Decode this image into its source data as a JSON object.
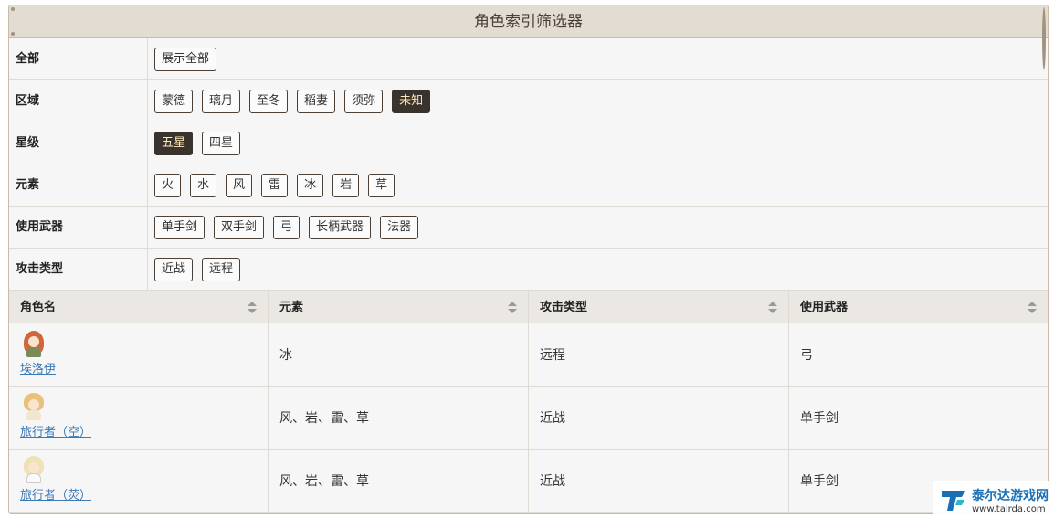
{
  "title": "角色索引筛选器",
  "filters": [
    {
      "label": "全部",
      "options": [
        {
          "text": "展示全部",
          "active": false
        }
      ]
    },
    {
      "label": "区域",
      "options": [
        {
          "text": "蒙德",
          "active": false
        },
        {
          "text": "璃月",
          "active": false
        },
        {
          "text": "至冬",
          "active": false
        },
        {
          "text": "稻妻",
          "active": false
        },
        {
          "text": "须弥",
          "active": false
        },
        {
          "text": "未知",
          "active": true
        }
      ]
    },
    {
      "label": "星级",
      "options": [
        {
          "text": "五星",
          "active": true
        },
        {
          "text": "四星",
          "active": false
        }
      ]
    },
    {
      "label": "元素",
      "options": [
        {
          "text": "火",
          "active": false
        },
        {
          "text": "水",
          "active": false
        },
        {
          "text": "风",
          "active": false
        },
        {
          "text": "雷",
          "active": false
        },
        {
          "text": "冰",
          "active": false
        },
        {
          "text": "岩",
          "active": false
        },
        {
          "text": "草",
          "active": false
        }
      ]
    },
    {
      "label": "使用武器",
      "options": [
        {
          "text": "单手剑",
          "active": false
        },
        {
          "text": "双手剑",
          "active": false
        },
        {
          "text": "弓",
          "active": false
        },
        {
          "text": "长柄武器",
          "active": false
        },
        {
          "text": "法器",
          "active": false
        }
      ]
    },
    {
      "label": "攻击类型",
      "options": [
        {
          "text": "近战",
          "active": false
        },
        {
          "text": "远程",
          "active": false
        }
      ]
    }
  ],
  "table": {
    "headers": [
      "角色名",
      "元素",
      "攻击类型",
      "使用武器"
    ],
    "rows": [
      {
        "name": "埃洛伊",
        "avatar": "aloy-avatar-icon",
        "element": "冰",
        "attack": "远程",
        "weapon": "弓"
      },
      {
        "name": "旅行者（空）",
        "avatar": "aether-avatar-icon",
        "element": "风、岩、雷、草",
        "attack": "近战",
        "weapon": "单手剑"
      },
      {
        "name": "旅行者（荧）",
        "avatar": "lumine-avatar-icon",
        "element": "风、岩、雷、草",
        "attack": "近战",
        "weapon": "单手剑"
      }
    ]
  },
  "watermark": {
    "line1": "泰尔达游戏网",
    "line2": "www.tairda.com"
  },
  "colors": {
    "active_bg": "#3a322c",
    "active_text": "#ffe9b7",
    "title_bg": "#e3dcd3",
    "link": "#3a7ab5"
  }
}
